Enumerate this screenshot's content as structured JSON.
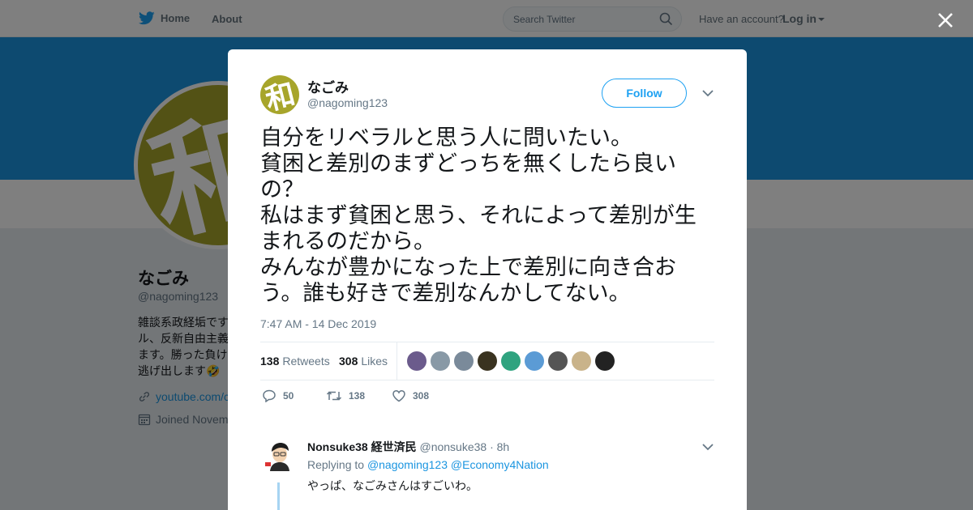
{
  "nav": {
    "home_label": "Home",
    "about_label": "About",
    "search_placeholder": "Search Twitter",
    "have_account": "Have an account?",
    "login_label": "Log in"
  },
  "profile": {
    "name": "なごみ",
    "handle": "@nagoming123",
    "bio_lines": [
      "雑談系政経垢です",
      "ル、反新自由主義",
      "ます。勝った負け",
      "逃げ出します🤣"
    ],
    "link": "youtube.com/c",
    "joined": "Joined Novem"
  },
  "tweet": {
    "author_name": "なごみ",
    "author_handle": "@nagoming123",
    "follow_label": "Follow",
    "text": "自分をリベラルと思う人に問いたい。\n貧困と差別のまずどっちを無くしたら良いの？\n私はまず貧困と思う、それによって差別が生まれるのだから。\nみんなが豊かになった上で差別に向き合おう。誰も好きで差別なんかしてない。",
    "timestamp": "7:47 AM - 14 Dec 2019",
    "retweets_count": "138",
    "retweets_label": "Retweets",
    "likes_count": "308",
    "likes_label": "Likes",
    "actions": {
      "reply_count": "50",
      "retweet_count": "138",
      "like_count": "308"
    },
    "liker_colors": [
      "#6b5b8c",
      "#8899a6",
      "#7a8a9a",
      "#3a3320",
      "#2fa37f",
      "#5b9bd5",
      "#555555",
      "#c9b38a",
      "#222222"
    ]
  },
  "reply": {
    "name": "Nonsuke38 経世済民",
    "handle": "@nonsuke38",
    "time": "· 8h",
    "replying_to_label": "Replying to",
    "mention1": "@nagoming123",
    "mention2": "@Economy4Nation",
    "text": "やっぱ、なごみさんはすごいわ。"
  },
  "colors": {
    "accent": "#1da1f2",
    "banner": "#1b95e0",
    "avatar": "#a7a52b"
  }
}
